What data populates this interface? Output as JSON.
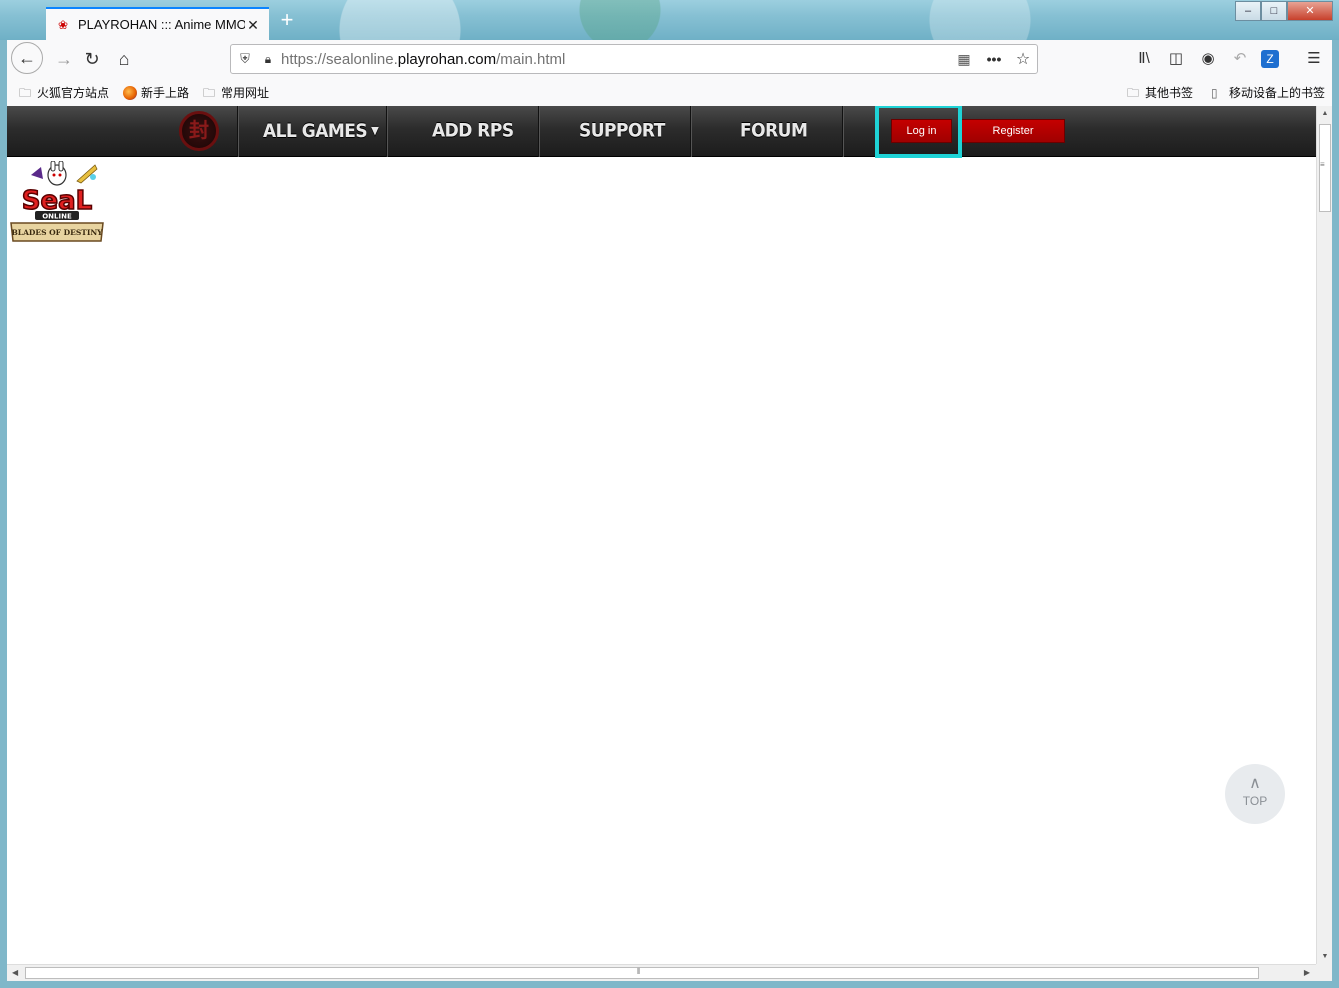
{
  "browser": {
    "tab_title": "PLAYROHAN ::: Anime MMO",
    "url_prefix": "https://sealonline.",
    "url_domain": "playrohan.com",
    "url_suffix": "/main.html",
    "bookmarks": [
      {
        "label": "火狐官方站点"
      },
      {
        "label": "新手上路"
      },
      {
        "label": "常用网址"
      },
      {
        "label": "其他书签"
      },
      {
        "label": "移动设备上的书签"
      }
    ]
  },
  "site": {
    "nav": {
      "all_games": "ALL GAMES",
      "add_rps": "ADD RPS",
      "support": "SUPPORT",
      "forum": "FORUM"
    },
    "login": "Log in",
    "register": "Register",
    "top_button": "TOP",
    "game_logo": {
      "title": "SeaL",
      "sub1": "ONLINE",
      "sub2": "BLADES OF DESTINY"
    }
  },
  "colors": {
    "highlight": "#1fd3d6",
    "button_red": "#c40000",
    "nav_dark": "#2c2c2c"
  }
}
